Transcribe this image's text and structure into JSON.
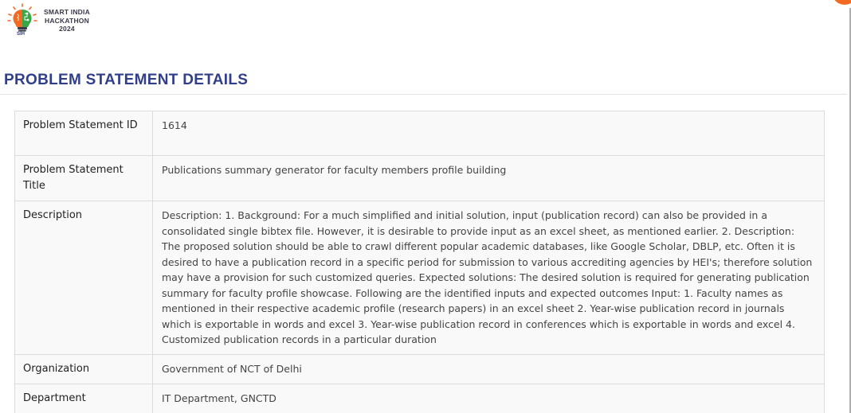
{
  "header": {
    "logo_lines": [
      "SMART INDIA",
      "HACKATHON",
      "2024"
    ],
    "logo_badge": "SIH"
  },
  "page_title": "PROBLEM STATEMENT DETAILS",
  "details": {
    "id_label": "Problem Statement ID",
    "id_value": "1614",
    "title_label": "Problem Statement Title",
    "title_value": "Publications summary generator for faculty members profile building",
    "description_label": "Description",
    "description_value": "Description: 1. Background: For a much simplified and initial solution, input (publication record) can also be provided in a consolidated single bibtex file. However, it is desirable to provide input as an excel sheet, as mentioned earlier. 2. Description: The proposed solution should be able to crawl different popular academic databases, like Google Scholar, DBLP, etc. Often it is desired to have a publication record in a specific period for submission to various accrediting agencies by HEI's; therefore solution may have a provision for such customized queries. Expected solutions: The desired solution is required for generating publication summary for faculty profile showcase. Following are the identified inputs and expected outcomes Input: 1. Faculty names as mentioned in their respective academic profile (research papers) in an excel sheet 2. Year-wise publication record in journals which is exportable in words and excel 3. Year-wise publication record in conferences which is exportable in words and excel 4. Customized publication records in a particular duration",
    "organization_label": "Organization",
    "organization_value": "Government of NCT of Delhi",
    "department_label": "Department",
    "department_value": "IT Department, GNCTD"
  },
  "colors": {
    "title": "#313e89",
    "accent_orange": "#f26a22",
    "logo_green": "#3aa64a"
  }
}
